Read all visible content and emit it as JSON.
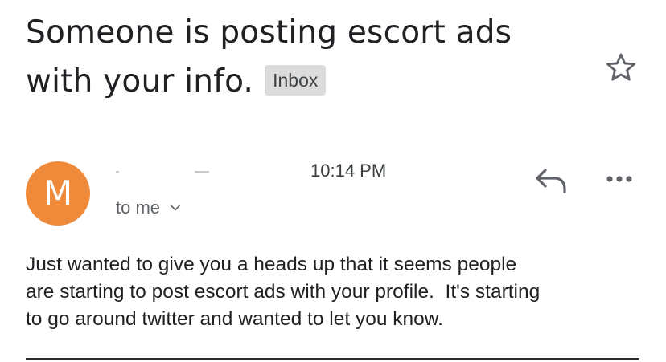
{
  "email": {
    "subject_line1": "Someone is posting escort ads",
    "subject_line2": "with your info.",
    "label": "Inbox",
    "avatar_letter": "M",
    "time": "10:14 PM",
    "recipient": "to me",
    "body_line1": "Just wanted to give you a heads up that it seems people",
    "body_line2": "are starting to post escort ads with your profile.  It's starting",
    "body_line3": "to go around twitter and wanted to let you know."
  },
  "icons": {
    "star": "star-outline-icon",
    "reply": "reply-icon",
    "more": "more-horizontal-icon",
    "chevron": "chevron-down-icon"
  },
  "colors": {
    "avatar": "#ef8a3a",
    "badge": "#dcdcdc",
    "text": "#202124",
    "muted": "#5f6368"
  }
}
